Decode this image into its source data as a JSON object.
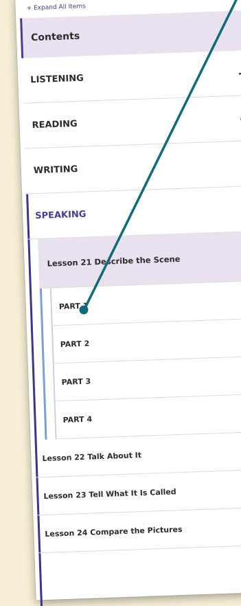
{
  "expand_label": "+ Expand All Items",
  "contents_title": "Contents",
  "sections": [
    {
      "label": "LISTENING",
      "toggle": "+"
    },
    {
      "label": "READING",
      "toggle": "+"
    },
    {
      "label": "WRITING",
      "toggle": "+"
    },
    {
      "label": "SPEAKING",
      "toggle": "−"
    }
  ],
  "open_lesson": {
    "label": "Lesson 21 Describe the Scene",
    "toggle": "−"
  },
  "parts": [
    "PART 1",
    "PART 2",
    "PART 3",
    "PART 4"
  ],
  "lessons": [
    {
      "label": "Lesson 22 Talk About It",
      "toggle": "+"
    },
    {
      "label": "Lesson 23 Tell What It Is Called",
      "toggle": "+"
    },
    {
      "label": "Lesson 24 Compare the Pictures",
      "toggle": "+"
    }
  ],
  "colors": {
    "accent": "#4a3b9a",
    "highlight_bg": "#e9e1ef",
    "pointer": "#0d6b7a",
    "backdrop": "#f7efd6"
  }
}
